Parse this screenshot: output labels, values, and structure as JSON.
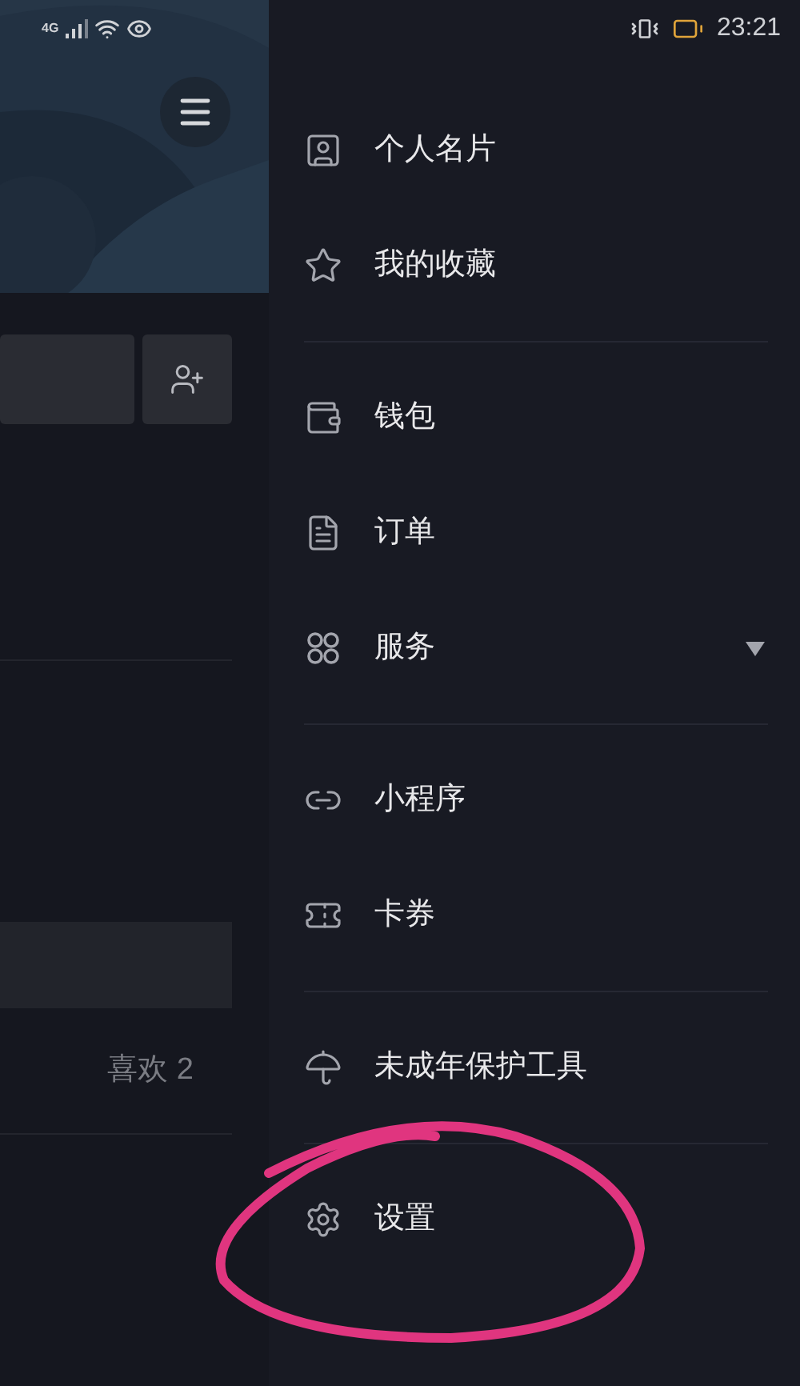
{
  "status_bar": {
    "network": "4G",
    "time": "23:21"
  },
  "profile_panel": {
    "liked_tab": "喜欢 2"
  },
  "drawer": {
    "sections": [
      {
        "items": [
          {
            "kind": "link",
            "label": "个人名片"
          },
          {
            "kind": "link",
            "label": "我的收藏"
          }
        ]
      },
      {
        "items": [
          {
            "kind": "link",
            "label": "钱包"
          },
          {
            "kind": "link",
            "label": "订单"
          },
          {
            "kind": "expandable",
            "label": "服务",
            "expanded": false
          }
        ]
      },
      {
        "items": [
          {
            "kind": "link",
            "label": "小程序"
          },
          {
            "kind": "link",
            "label": "卡券"
          }
        ]
      },
      {
        "items": [
          {
            "kind": "link",
            "label": "未成年保护工具"
          }
        ]
      },
      {
        "items": [
          {
            "kind": "link",
            "label": "设置"
          }
        ]
      }
    ]
  }
}
